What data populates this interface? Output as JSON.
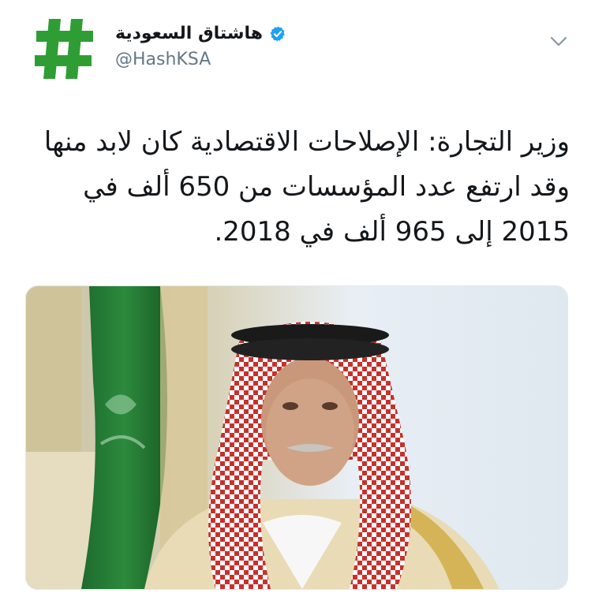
{
  "tweet": {
    "display_name": "هاشتاق السعودية",
    "handle": "@HashKSA",
    "verified": true,
    "text": "وزير التجارة: الإصلاحات الاقتصادية كان لابد منها وقد ارتفع عدد المؤسسات من 650 ألف في 2015 إلى 965 ألف في 2018.",
    "icons": {
      "avatar": "hashtag-logo-icon",
      "verified": "verified-badge-icon",
      "menu": "chevron-down-icon"
    },
    "colors": {
      "logo_green": "#2e9e34",
      "verified_blue": "#1da1f2",
      "handle_gray": "#657786"
    }
  }
}
